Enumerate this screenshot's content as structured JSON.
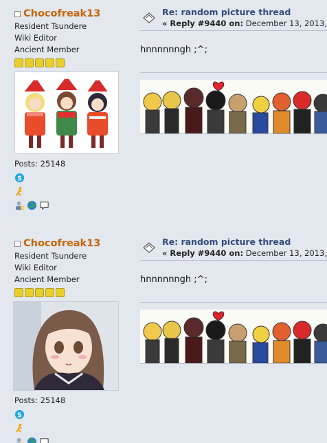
{
  "posts": [
    {
      "author": "Chocofreak13",
      "titles": [
        "Resident Tsundere",
        "Wiki Editor",
        "Ancient Member"
      ],
      "stars": 5,
      "posts_label": "Posts: 25148",
      "subject": "Re: random picture thread",
      "reply_prefix": "« Reply #9440 on:",
      "date": "December 13, 2013,",
      "body": "hnnnnnngh ;^;",
      "icons": [
        "skype-icon",
        "aim-icon",
        "profile-icon",
        "website-icon",
        "pm-icon"
      ]
    },
    {
      "author": "Chocofreak13",
      "titles": [
        "Resident Tsundere",
        "Wiki Editor",
        "Ancient Member"
      ],
      "stars": 5,
      "posts_label": "Posts: 25148",
      "subject": "Re: random picture thread",
      "reply_prefix": "« Reply #9440 on:",
      "date": "December 13, 2013,",
      "body": "hnnnnnngh ;^;",
      "icons": [
        "skype-icon",
        "aim-icon",
        "profile-icon",
        "website-icon",
        "pm-icon"
      ]
    }
  ],
  "colors": {
    "author": "#c46508",
    "subject": "#344c7a",
    "star": "#e8cf2c",
    "background": "#e3e7ee"
  }
}
